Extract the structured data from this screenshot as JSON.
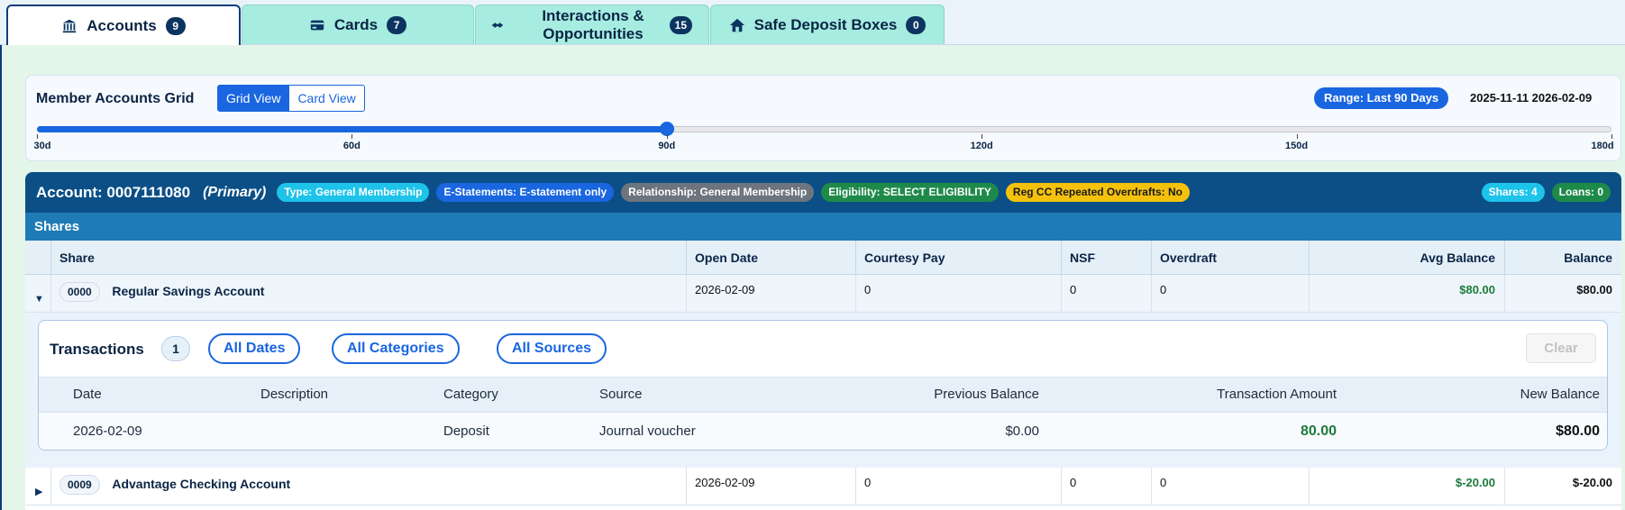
{
  "tabs": [
    {
      "label": "Accounts",
      "count": "9",
      "icon": "bank-icon"
    },
    {
      "label": "Cards",
      "count": "7",
      "icon": "credit-card-icon"
    },
    {
      "label": "Interactions & Opportunities",
      "count": "15",
      "icon": "handshake-icon"
    },
    {
      "label": "Safe Deposit Boxes",
      "count": "0",
      "icon": "home-icon"
    }
  ],
  "grid": {
    "title": "Member Accounts Grid",
    "view_grid": "Grid View",
    "view_card": "Card View",
    "range_label": "Range: Last 90 Days",
    "range_dates": "2025-11-11 2026-02-09",
    "slider": {
      "min": 30,
      "max": 180,
      "value": 90,
      "ticks": [
        "30d",
        "60d",
        "90d",
        "120d",
        "150d",
        "180d"
      ]
    }
  },
  "account": {
    "title": "Account: 0007111080",
    "primary": "(Primary)",
    "chips": [
      {
        "text": "Type: General Membership",
        "color": "#1ec3ea"
      },
      {
        "text": "E-Statements: E-statement only",
        "color": "#1a66e0"
      },
      {
        "text": "Relationship: General Membership",
        "color": "#6c757d"
      },
      {
        "text": "Eligibility: SELECT ELIGIBILITY",
        "color": "#1e8a4a"
      },
      {
        "text": "Reg CC Repeated Overdrafts: No",
        "color": "#f4c20d"
      }
    ],
    "shares_count": "Shares: 4",
    "loans_count": "Loans: 0",
    "section_label": "Shares",
    "columns": [
      "Share",
      "Open Date",
      "Courtesy Pay",
      "NSF",
      "Overdraft",
      "Avg Balance",
      "Balance"
    ],
    "rows": [
      {
        "num": "0000",
        "name": "Regular Savings Account",
        "open_date": "2026-02-09",
        "courtesy": "0",
        "nsf": "0",
        "overdraft": "0",
        "avg": "$80.00",
        "balance": "$80.00",
        "expanded": true
      },
      {
        "num": "0009",
        "name": "Advantage Checking Account",
        "open_date": "2026-02-09",
        "courtesy": "0",
        "nsf": "0",
        "overdraft": "0",
        "avg": "$-20.00",
        "balance": "$-20.00",
        "expanded": false
      }
    ]
  },
  "transactions": {
    "title": "Transactions",
    "count": "1",
    "filters": [
      "All Dates",
      "All Categories",
      "All Sources"
    ],
    "clear_label": "Clear",
    "columns": [
      "Date",
      "Description",
      "Category",
      "Source",
      "Previous Balance",
      "Transaction Amount",
      "New Balance"
    ],
    "rows": [
      {
        "date": "2026-02-09",
        "description": "",
        "category": "Deposit",
        "source": "Journal voucher",
        "previous": "$0.00",
        "amount": "80.00",
        "new_balance": "$80.00"
      }
    ]
  },
  "colors": {
    "accent": "#1a66e0",
    "header_dark": "#0b4f86",
    "shares_bar": "#1f7bb5",
    "tab_bg": "#a6ece0",
    "positive": "#1d7a3a"
  }
}
